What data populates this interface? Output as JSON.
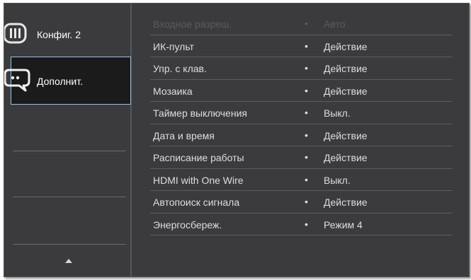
{
  "sidebar": {
    "items": [
      {
        "label": "Конфиг. 2",
        "icon": "settings-bars-icon",
        "selected": false
      },
      {
        "label": "Дополнит.",
        "icon": "chat-dots-icon",
        "selected": true
      }
    ],
    "scroll_icon": "triangle-up-icon"
  },
  "menu": {
    "rows": [
      {
        "label": "Входное разреш.",
        "value": "Авто",
        "enabled": false
      },
      {
        "label": "ИК-пульт",
        "value": "Действие",
        "enabled": true
      },
      {
        "label": "Упр. с клав.",
        "value": "Действие",
        "enabled": true
      },
      {
        "label": "Мозаика",
        "value": "Действие",
        "enabled": true
      },
      {
        "label": "Таймер выключения",
        "value": "Выкл.",
        "enabled": true
      },
      {
        "label": "Дата и время",
        "value": "Действие",
        "enabled": true
      },
      {
        "label": "Расписание работы",
        "value": "Действие",
        "enabled": true
      },
      {
        "label": "HDMI with One Wire",
        "value": "Выкл.",
        "enabled": true
      },
      {
        "label": "Автопоиск сигнала",
        "value": "Действие",
        "enabled": true
      },
      {
        "label": "Энергосбереж.",
        "value": "Режим 4",
        "enabled": true
      }
    ],
    "bullet": "•"
  },
  "colors": {
    "background": "#3b3b3d",
    "focus_border": "#8fc3ee",
    "text": "#dedede",
    "disabled_text": "#5a5b5e"
  }
}
